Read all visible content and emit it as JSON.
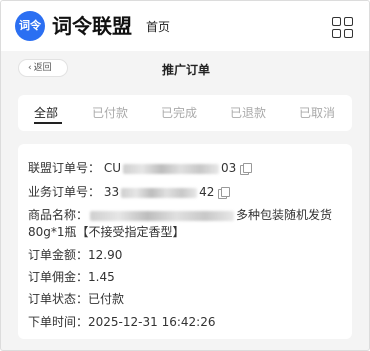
{
  "header": {
    "logo_text": "词令",
    "brand": "词令联盟",
    "nav_home": "首页"
  },
  "page": {
    "back_label": "返回",
    "title": "推广订单"
  },
  "tabs": [
    {
      "label": "全部",
      "active": true
    },
    {
      "label": "已付款",
      "active": false
    },
    {
      "label": "已完成",
      "active": false
    },
    {
      "label": "已退款",
      "active": false
    },
    {
      "label": "已取消",
      "active": false
    }
  ],
  "order": {
    "union_order_label": "联盟订单号：",
    "union_order_prefix": "CU",
    "union_order_suffix": "03",
    "biz_order_label": "业务订单号：",
    "biz_order_prefix": "33",
    "biz_order_suffix": "42",
    "product_label": "商品名称：",
    "product_line1_visible": "多种包装随机发货",
    "product_line2": "80g*1瓶【不接受指定香型】",
    "amount_label": "订单金额：",
    "amount": "12.90",
    "commission_label": "订单佣金：",
    "commission": "1.45",
    "status_label": "订单状态：",
    "status": "已付款",
    "time_label": "下单时间：",
    "time": "2025-12-31 16:42:26"
  }
}
